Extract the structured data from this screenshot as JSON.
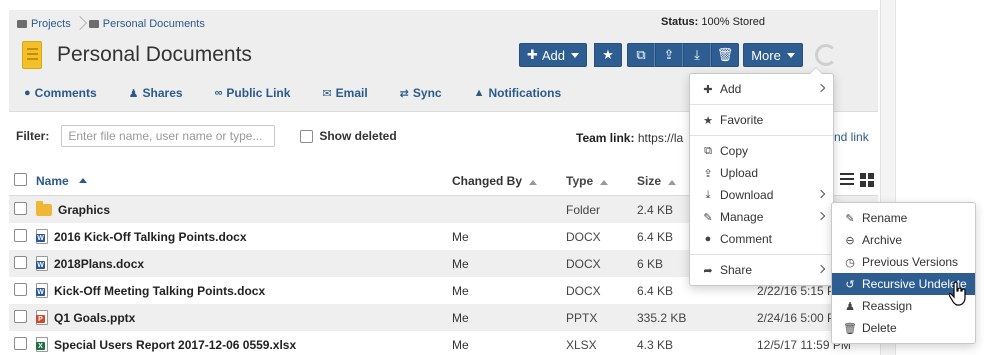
{
  "breadcrumb": {
    "items": [
      "Projects",
      "Personal Documents"
    ]
  },
  "status": {
    "label": "Status:",
    "value": "100% Stored"
  },
  "page_title": "Personal Documents",
  "toolbar": {
    "add_label": "Add",
    "more_label": "More"
  },
  "subnav": {
    "items": [
      {
        "label": "Comments",
        "icon": "comment-icon"
      },
      {
        "label": "Shares",
        "icon": "user-icon"
      },
      {
        "label": "Public Link",
        "icon": "link-icon"
      },
      {
        "label": "Email",
        "icon": "envelope-icon"
      },
      {
        "label": "Sync",
        "icon": "sync-icon"
      },
      {
        "label": "Notifications",
        "icon": "bell-icon"
      }
    ]
  },
  "filter": {
    "label": "Filter:",
    "placeholder": "Enter file name, user name or type...",
    "show_deleted": "Show deleted"
  },
  "team_link": {
    "label": "Team link:",
    "url_fragment": "https://la",
    "action_fragment": "nd link"
  },
  "table": {
    "headers": {
      "name": "Name",
      "changed_by": "Changed By",
      "type": "Type",
      "size": "Size"
    },
    "rows": [
      {
        "name": "Graphics",
        "changed_by": "",
        "type": "Folder",
        "size": "2.4 KB",
        "date": "",
        "kind": "folder"
      },
      {
        "name": "2016 Kick-Off Talking Points.docx",
        "changed_by": "Me",
        "type": "DOCX",
        "size": "6.4 KB",
        "date": "",
        "kind": "word"
      },
      {
        "name": "2018Plans.docx",
        "changed_by": "Me",
        "type": "DOCX",
        "size": "6 KB",
        "date": "",
        "kind": "word"
      },
      {
        "name": "Kick-Off Meeting Talking Points.docx",
        "changed_by": "Me",
        "type": "DOCX",
        "size": "6.4 KB",
        "date": "2/22/16 5:15 PM",
        "kind": "word"
      },
      {
        "name": "Q1 Goals.pptx",
        "changed_by": "Me",
        "type": "PPTX",
        "size": "335.2 KB",
        "date": "2/24/16 5:00 PM",
        "kind": "ppt"
      },
      {
        "name": "Special Users Report 2017-12-06 0559.xlsx",
        "changed_by": "Me",
        "type": "XLSX",
        "size": "4.3 KB",
        "date": "12/5/17 11:59 PM",
        "kind": "xls"
      }
    ]
  },
  "more_menu": {
    "items": [
      {
        "label": "Add",
        "icon": "plus-icon",
        "submenu": true
      },
      {
        "label": "Favorite",
        "icon": "star-icon",
        "submenu": false
      },
      {
        "label": "Copy",
        "icon": "copy-icon",
        "submenu": false
      },
      {
        "label": "Upload",
        "icon": "upload-icon",
        "submenu": false
      },
      {
        "label": "Download",
        "icon": "download-icon",
        "submenu": true
      },
      {
        "label": "Manage",
        "icon": "wrench-icon",
        "submenu": true
      },
      {
        "label": "Comment",
        "icon": "comment-icon",
        "submenu": false
      },
      {
        "label": "Share",
        "icon": "share-icon",
        "submenu": true
      }
    ]
  },
  "manage_submenu": {
    "items": [
      {
        "label": "Rename",
        "icon": "pencil-icon"
      },
      {
        "label": "Archive",
        "icon": "archive-icon"
      },
      {
        "label": "Previous Versions",
        "icon": "clock-icon"
      },
      {
        "label": "Recursive Undelete",
        "icon": "undo-icon",
        "active": true
      },
      {
        "label": "Reassign",
        "icon": "user-icon"
      },
      {
        "label": "Delete",
        "icon": "trash-icon"
      }
    ]
  },
  "colors": {
    "primary": "#2e5d92",
    "link": "#2a5a8c",
    "header_band": "#eeeeee"
  }
}
